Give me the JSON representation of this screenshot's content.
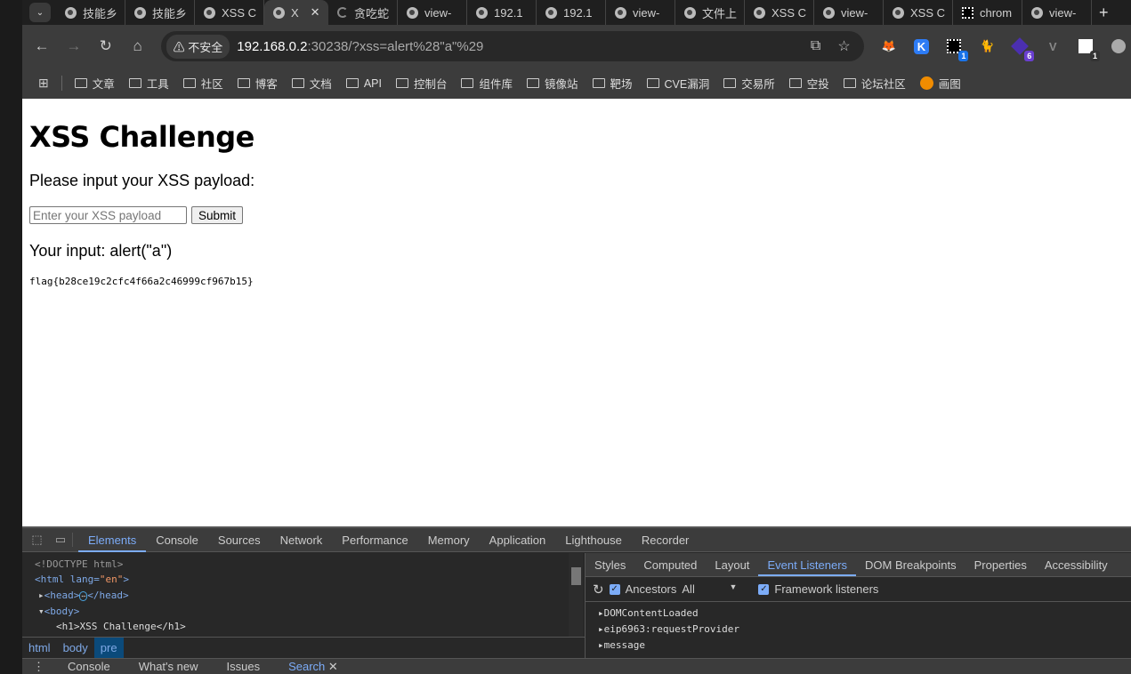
{
  "browser": {
    "tabs": [
      {
        "title": "技能乡",
        "icon": "globe-icon"
      },
      {
        "title": "技能乡",
        "icon": "globe-icon"
      },
      {
        "title": "XSS C",
        "icon": "globe-icon"
      },
      {
        "title": "X",
        "icon": "globe-icon",
        "active": true
      },
      {
        "title": "贪吃蛇",
        "icon": "loading-spinner"
      },
      {
        "title": "view-",
        "icon": "globe-icon"
      },
      {
        "title": "192.1",
        "icon": "globe-icon"
      },
      {
        "title": "192.1",
        "icon": "globe-icon"
      },
      {
        "title": "view-",
        "icon": "globe-icon"
      },
      {
        "title": "文件上",
        "icon": "globe-icon"
      },
      {
        "title": "XSS C",
        "icon": "globe-icon"
      },
      {
        "title": "view-",
        "icon": "globe-icon"
      },
      {
        "title": "XSS C",
        "icon": "globe-icon"
      },
      {
        "title": "chrom",
        "icon": "chrome-ext-icon"
      },
      {
        "title": "view-",
        "icon": "globe-icon"
      }
    ],
    "security_label": "不安全",
    "url_host": "192.168.0.2",
    "url_rest": ":30238/?xss=alert%28\"a\"%29",
    "extension_badges": [
      "1",
      "6",
      "1"
    ],
    "bookmarks": [
      "文章",
      "工具",
      "社区",
      "博客",
      "文档",
      "API",
      "控制台",
      "组件库",
      "镜像站",
      "靶场",
      "CVE漏洞",
      "交易所",
      "空投",
      "论坛社区"
    ],
    "bookmark_special": "画图"
  },
  "page": {
    "title": "XSS Challenge",
    "prompt": "Please input your XSS payload:",
    "input_placeholder": "Enter your XSS payload",
    "submit_label": "Submit",
    "your_input": "Your input: alert(\"a\")",
    "flag": "flag{b28ce19c2cfc4f66a2c46999cf967b15}"
  },
  "devtools": {
    "tabs": [
      "Elements",
      "Console",
      "Sources",
      "Network",
      "Performance",
      "Memory",
      "Application",
      "Lighthouse",
      "Recorder"
    ],
    "active_tab": "Elements",
    "dom": {
      "doctype": "<!DOCTYPE html>",
      "html_open": "<html lang=",
      "lang": "\"en\"",
      "head": "<head>",
      "head_close": "</head>",
      "body": "<body>",
      "h1": "<h1>XSS Challenge</h1>"
    },
    "breadcrumbs": [
      "html",
      "body",
      "pre"
    ],
    "side_tabs": [
      "Styles",
      "Computed",
      "Layout",
      "Event Listeners",
      "DOM Breakpoints",
      "Properties",
      "Accessibility"
    ],
    "ancestors_label": "Ancestors",
    "filter_value": "All",
    "framework_label": "Framework listeners",
    "listeners": [
      "DOMContentLoaded",
      "eip6963:requestProvider",
      "message"
    ],
    "drawer_tabs": [
      "Console",
      "What's new",
      "Issues",
      "Search"
    ]
  }
}
